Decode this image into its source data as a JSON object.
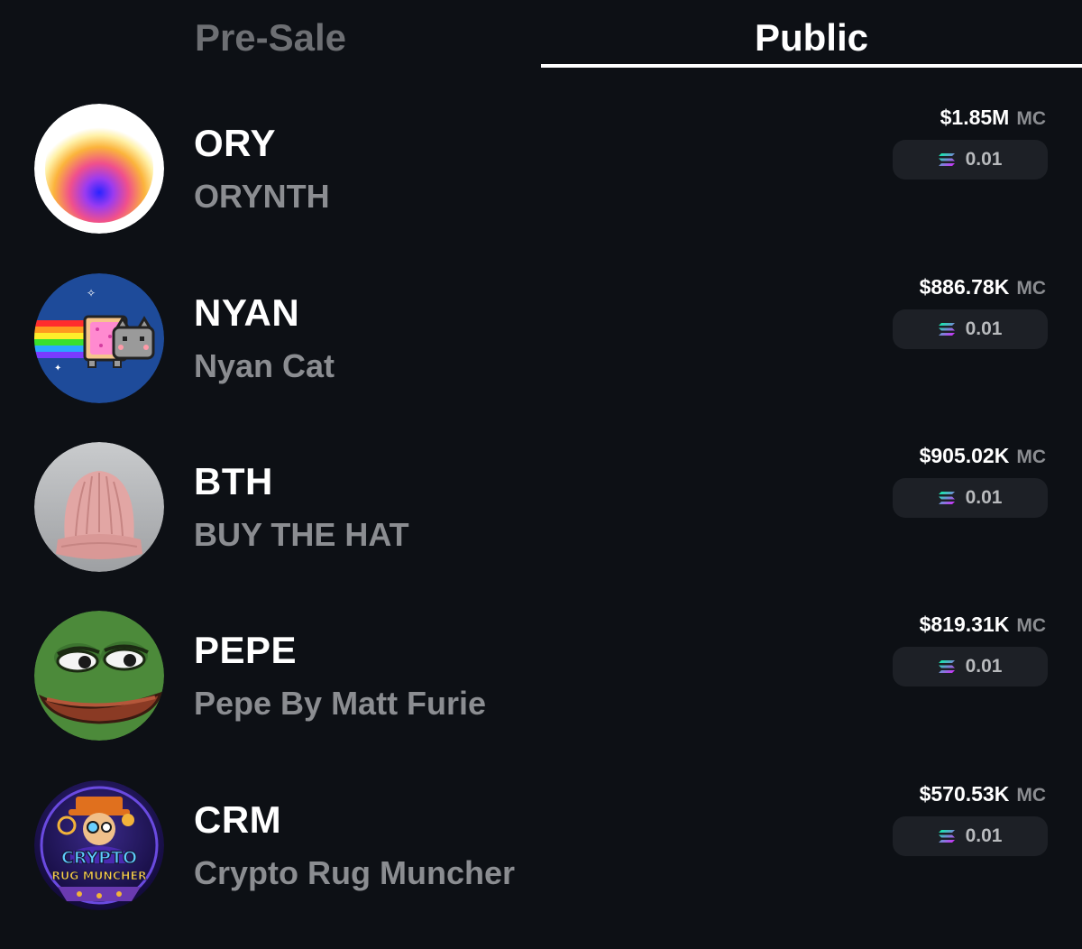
{
  "tabs": [
    {
      "label": "Pre-Sale",
      "active": false
    },
    {
      "label": "Public",
      "active": true
    }
  ],
  "tokens": [
    {
      "symbol": "ORY",
      "name": "ORYNTH",
      "market_cap": "$1.85M",
      "mc_unit": "MC",
      "buy_amount": "0.01",
      "avatar": "gradient-orb-avatar"
    },
    {
      "symbol": "NYAN",
      "name": "Nyan Cat",
      "market_cap": "$886.78K",
      "mc_unit": "MC",
      "buy_amount": "0.01",
      "avatar": "nyan-cat-avatar"
    },
    {
      "symbol": "BTH",
      "name": "BUY THE HAT",
      "market_cap": "$905.02K",
      "mc_unit": "MC",
      "buy_amount": "0.01",
      "avatar": "pink-knit-hat-avatar"
    },
    {
      "symbol": "PEPE",
      "name": "Pepe By Matt Furie",
      "market_cap": "$819.31K",
      "mc_unit": "MC",
      "buy_amount": "0.01",
      "avatar": "pepe-frog-avatar"
    },
    {
      "symbol": "CRM",
      "name": "Crypto Rug Muncher",
      "market_cap": "$570.53K",
      "mc_unit": "MC",
      "buy_amount": "0.01",
      "avatar": "crypto-rug-muncher-avatar",
      "avatar_text": [
        "CRYPTO",
        "RUG MUNCHER"
      ]
    }
  ],
  "icons": {
    "currency": "solana-icon"
  },
  "colors": {
    "background": "#0d1015",
    "pill": "#1d2026",
    "muted_text": "#8b8d91",
    "accent": "#ffffff"
  }
}
